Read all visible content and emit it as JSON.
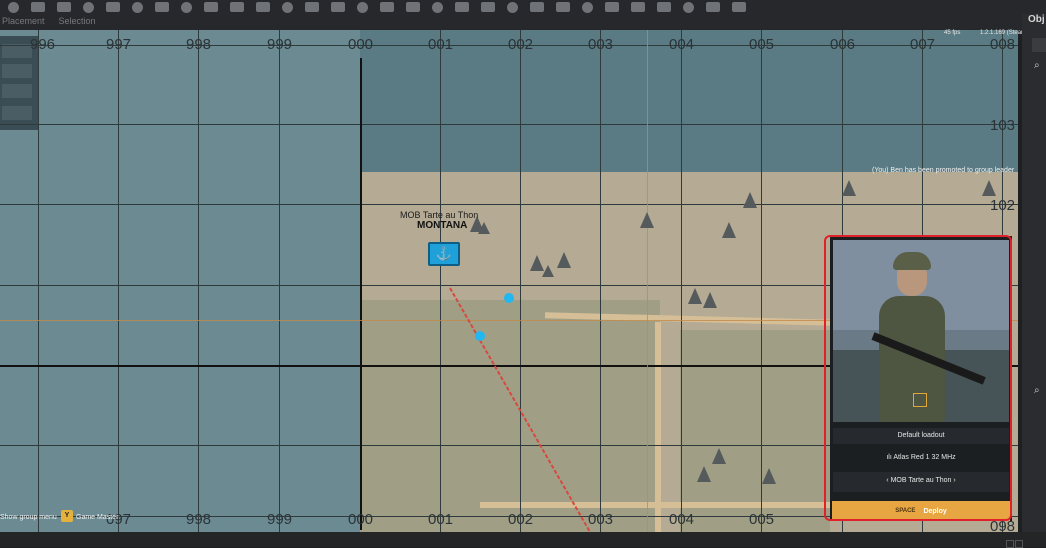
{
  "toolbar": {
    "labels": [
      "Placement",
      "Selection"
    ]
  },
  "right_panel": {
    "tab_label": "Obj"
  },
  "map": {
    "top_x_labels": [
      "996",
      "997",
      "998",
      "999",
      "000",
      "001",
      "002",
      "003",
      "004",
      "005",
      "006",
      "007",
      "008"
    ],
    "bottom_x_labels": [
      "097",
      "998",
      "999",
      "000",
      "001",
      "002",
      "003",
      "004",
      "005"
    ],
    "y_labels": [
      "103",
      "102"
    ],
    "bottom_right_label": "098",
    "base": {
      "name": "MOB Tarte au Thon",
      "callsign": "MONTANA",
      "icon": "anchor-icon"
    },
    "hud": {
      "fps": "45 fps",
      "version": "1.2.1.169 (Steam)",
      "notification": "(You) Ben has been promoted to group leader"
    }
  },
  "deploy_panel": {
    "loadout": "Default loadout",
    "radio": "Atlas Red 1 32 MHz",
    "spawn_point": "MOB Tarte au Thon",
    "deploy_key": "SPACE",
    "deploy_label": "Deploy",
    "slot_icon": "slot-icon"
  },
  "hints": {
    "group_menu": "Show group menu",
    "game_master_key": "Y",
    "game_master": "Game Master"
  },
  "colors": {
    "accent": "#e7a641",
    "marker": "#1fa0d8",
    "annotation": "#e0212a"
  }
}
